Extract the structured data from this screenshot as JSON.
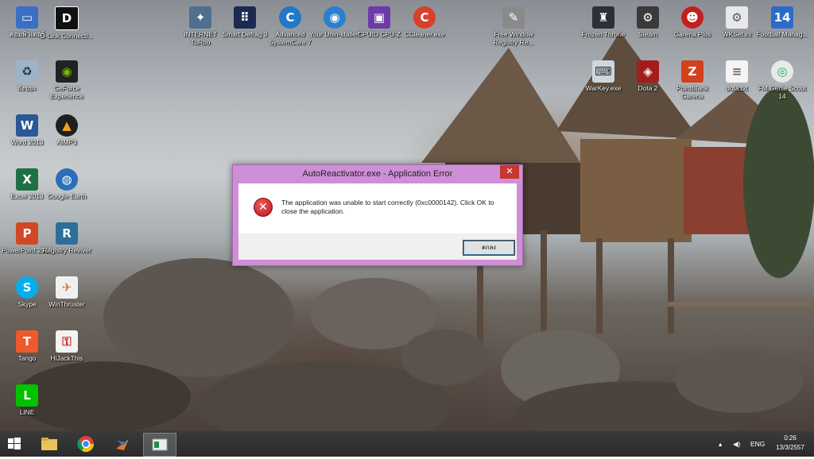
{
  "desktop": {
    "icons": [
      {
        "id": "thai-computer",
        "label": "คอมพิวเตอร์",
        "icon": "computer-icon"
      },
      {
        "id": "dlink",
        "label": "D-Link Connecti...",
        "icon": "dlink-icon"
      },
      {
        "id": "internet-turbo",
        "label": "INTERNET TuRbo",
        "icon": "internet-turbo-icon"
      },
      {
        "id": "smart-defrag",
        "label": "Smart Defrag 3",
        "icon": "smart-defrag-icon"
      },
      {
        "id": "advanced-systemcare",
        "label": "Advanced SystemCare 7",
        "icon": "advanced-systemcare-icon"
      },
      {
        "id": "your-uninstaller",
        "label": "Your Unin-staller!",
        "icon": "your-uninstaller-icon"
      },
      {
        "id": "cpuid",
        "label": "CPUID CPU-Z",
        "icon": "cpuz-icon"
      },
      {
        "id": "ccleaner",
        "label": "CCleaner.exe",
        "icon": "ccleaner-icon"
      },
      {
        "id": "free-window-registry",
        "label": "Free Window Registry Re...",
        "icon": "registry-repair-icon"
      },
      {
        "id": "frozen-throne",
        "label": "Frozen Throne",
        "icon": "frozen-throne-icon"
      },
      {
        "id": "steam",
        "label": "Steam",
        "icon": "steam-icon"
      },
      {
        "id": "garena-plus",
        "label": "Garena Plus",
        "icon": "garena-icon"
      },
      {
        "id": "wkset",
        "label": "WKSet.ini",
        "icon": "ini-file-icon"
      },
      {
        "id": "football-manager",
        "label": "Football Manag...",
        "icon": "football-manager-icon"
      },
      {
        "id": "recycle-bin",
        "label": "ถังขยะ",
        "icon": "recycle-bin-icon"
      },
      {
        "id": "geforce",
        "label": "GeForce Experience",
        "icon": "geforce-icon"
      },
      {
        "id": "warkey",
        "label": "WarKey.exe",
        "icon": "warkey-icon"
      },
      {
        "id": "dota2",
        "label": "Dota 2",
        "icon": "dota2-icon"
      },
      {
        "id": "pointblank",
        "label": "PointBlank Garena",
        "icon": "pointblank-icon"
      },
      {
        "id": "dota-txt",
        "label": "dota.txt",
        "icon": "text-file-icon"
      },
      {
        "id": "fm-genie",
        "label": "FM Genie Scout 14",
        "icon": "fm-genie-icon"
      },
      {
        "id": "word",
        "label": "Word 2013",
        "icon": "word-icon"
      },
      {
        "id": "aimp3",
        "label": "AIMP3",
        "icon": "aimp-icon"
      },
      {
        "id": "excel",
        "label": "Excel 2013",
        "icon": "excel-icon"
      },
      {
        "id": "google-earth",
        "label": "Google Earth",
        "icon": "google-earth-icon"
      },
      {
        "id": "powerpoint",
        "label": "PowerPoint 2013",
        "icon": "powerpoint-icon"
      },
      {
        "id": "registry-reviver",
        "label": "Registry Reviver",
        "icon": "registry-reviver-icon"
      },
      {
        "id": "skype",
        "label": "Skype",
        "icon": "skype-icon"
      },
      {
        "id": "winthruster",
        "label": "WinThruster",
        "icon": "winthruster-icon"
      },
      {
        "id": "tango",
        "label": "Tango",
        "icon": "tango-icon"
      },
      {
        "id": "hijackthis",
        "label": "HiJackThis",
        "icon": "hijackthis-icon"
      },
      {
        "id": "line",
        "label": "LINE",
        "icon": "line-icon"
      }
    ]
  },
  "dialog": {
    "title": "AutoReactivator.exe - Application Error",
    "close_glyph": "✕",
    "error_glyph": "✕",
    "message": "The application was unable to start correctly (0xc0000142). Click OK to close the application.",
    "ok_label": "ตกลง"
  },
  "taskbar": {
    "language": "ENG",
    "time": "0:26",
    "date": "13/3/2557"
  },
  "colors": {
    "dialog_frame": "#cf8fd6",
    "close_button": "#c7372f",
    "taskbar": "#2e2e2e"
  }
}
